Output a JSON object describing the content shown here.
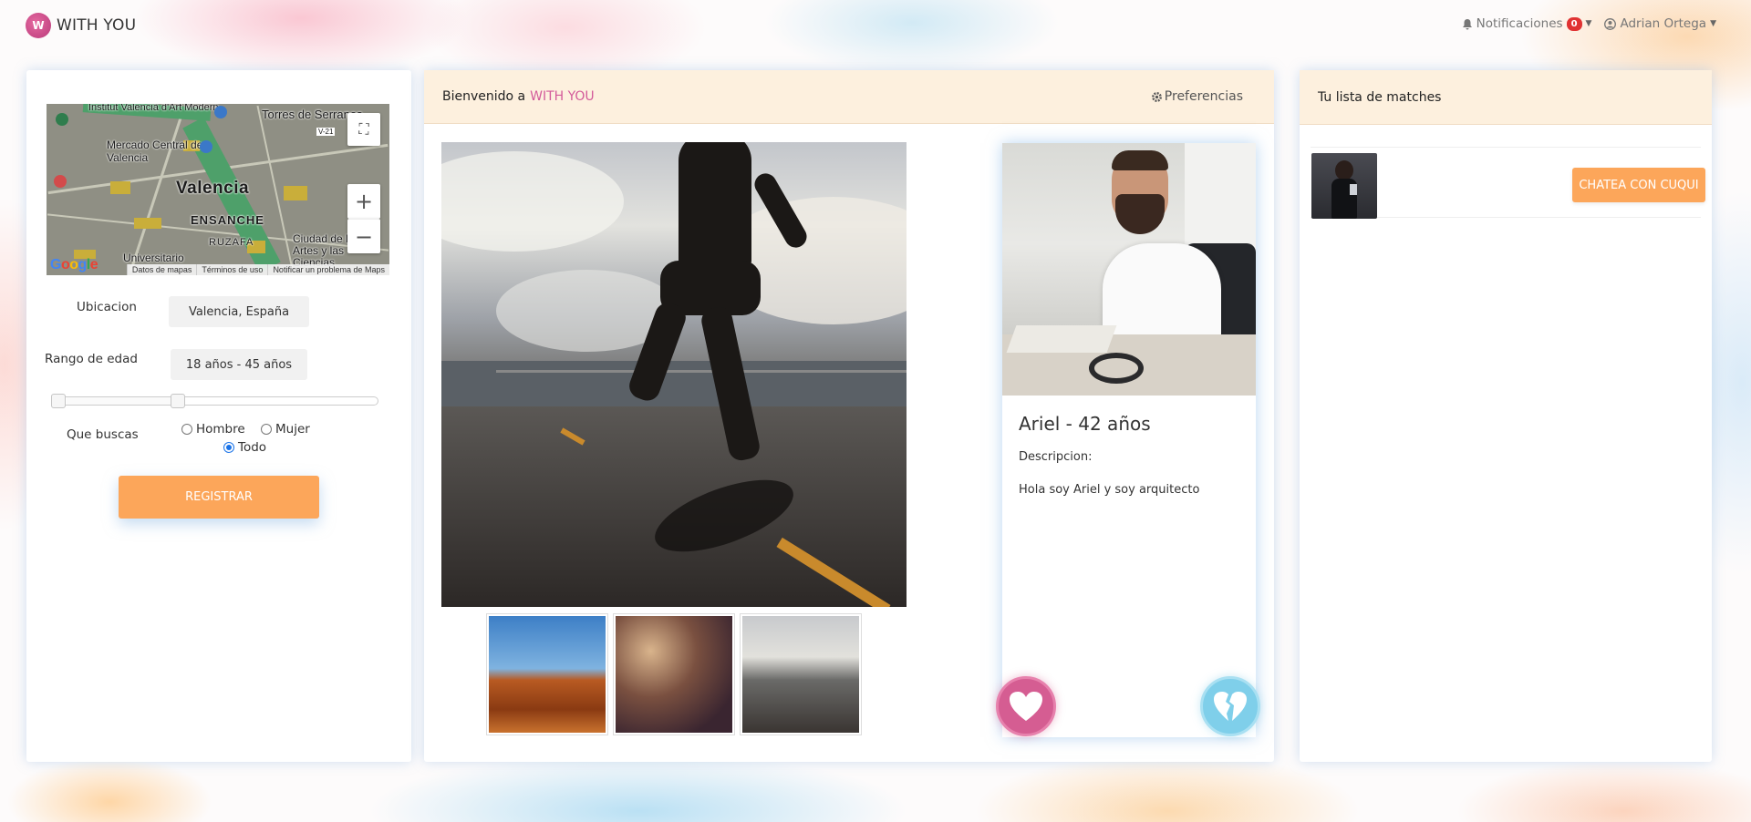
{
  "nav": {
    "brand": "WITH YOU",
    "logo_text": "W",
    "notifications_label": "Notificaciones",
    "notifications_count": "0",
    "user_name": "Adrian Ortega"
  },
  "filters": {
    "map": {
      "labels": [
        "Institut Valencià d'Art Modern",
        "Torres de Serranos",
        "Mercado Central de Valencia",
        "Valencia",
        "ENSANCHE",
        "RUZAFA",
        "Ciudad de las Artes y las Ciencias",
        "Universitario",
        "V-21"
      ],
      "footer": [
        "Datos de mapas",
        "Términos de uso",
        "Notificar un problema de Maps"
      ],
      "zoom_in": "+",
      "zoom_out": "−"
    },
    "location_label": "Ubicacion",
    "location_value": "Valencia, España",
    "age_label": "Rango de edad",
    "age_value": "18 años - 45 años",
    "age_min": 18,
    "age_max": 45,
    "seeking_label": "Que buscas",
    "options": [
      "Hombre",
      "Mujer",
      "Todo"
    ],
    "selected_option": "Todo",
    "register_label": "REGISTRAR"
  },
  "center": {
    "welcome": "Bienvenido a",
    "brand": "WITH YOU",
    "preferences_label": "Preferencias",
    "thumbnails": [
      "desert-canyon",
      "party-confetti",
      "runner-road"
    ]
  },
  "profile": {
    "name_age": "Ariel - 42 años",
    "description_label": "Descripcion:",
    "description": "Hola soy Ariel y soy arquitecto"
  },
  "matches": {
    "title": "Tu lista de matches",
    "items": [
      {
        "chat_label": "CHATEA CON CUQUI"
      }
    ]
  },
  "colors": {
    "accent_pink": "#d35a9a",
    "orange_button": "#fca65a",
    "header_bg": "#fdf0de",
    "like": "#d55d92",
    "dislike": "#7fcfea"
  }
}
